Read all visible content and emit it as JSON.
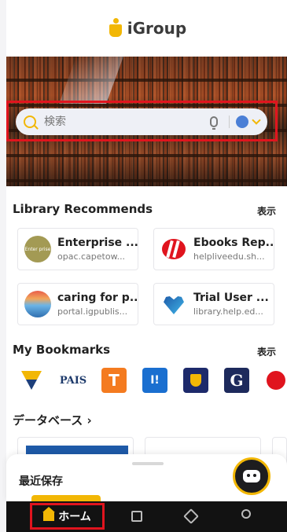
{
  "header": {
    "logo_text": "iGroup"
  },
  "search": {
    "placeholder": "検索"
  },
  "library": {
    "title": "Library Recommends",
    "action": "表示",
    "cards": [
      {
        "title": "Enterprise ...",
        "url": "opac.capetow...",
        "icon_label": "Enter prise"
      },
      {
        "title": "Ebooks Rep...",
        "url": "helpliveedu.sh..."
      },
      {
        "title": "caring for p...",
        "url": "portal.igpublis..."
      },
      {
        "title": "Trial User ...",
        "url": "library.help.ed..."
      }
    ]
  },
  "bookmarks": {
    "title": "My Bookmarks",
    "action": "表示",
    "items": [
      {
        "label": ""
      },
      {
        "label": "PAIS"
      },
      {
        "label": "T"
      },
      {
        "label": "I!"
      },
      {
        "label": ""
      },
      {
        "label": "G"
      },
      {
        "label": ""
      }
    ]
  },
  "database": {
    "title": "データベース"
  },
  "sheet": {
    "title": "最近保存"
  },
  "nav": {
    "home_label": "ホーム"
  },
  "colors": {
    "accent": "#f2b705",
    "highlight": "#e0141e",
    "nav_bg": "#121212"
  }
}
